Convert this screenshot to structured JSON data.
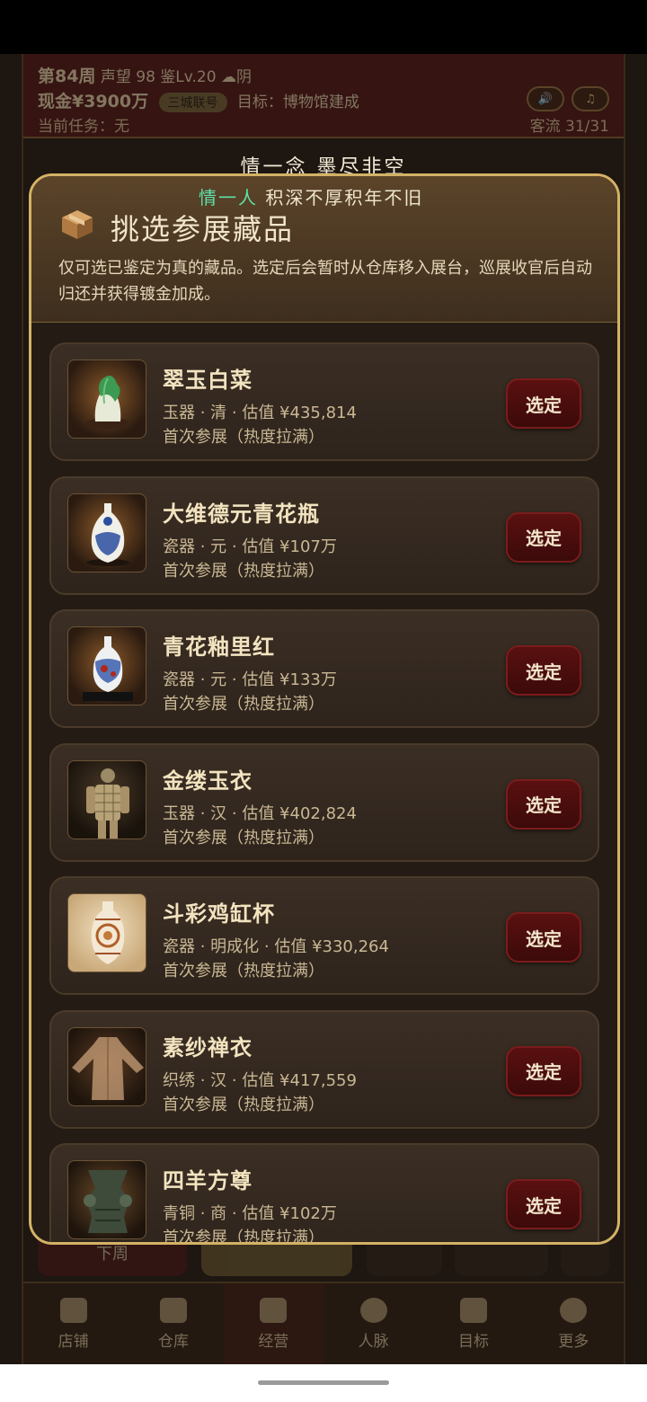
{
  "header": {
    "week": "第84周",
    "reputation": "声望 98",
    "appraisal_level": "鉴Lv.20",
    "weather": "☁阴",
    "cash": "现金¥3900万",
    "chip": "三城联号",
    "goal": "目标：博物馆建成",
    "task": "当前任务：无",
    "traffic": "客流 31/31",
    "btn_sound": "🔊",
    "btn_music": "♫"
  },
  "poem_top": "情一念 墨尽非空",
  "poem_modal": {
    "highlight": "情一人",
    "rest": " 积深不厚积年不旧"
  },
  "modal": {
    "icon": "package-icon",
    "title": "挑选参展藏品",
    "description": "仅可选已鉴定为真的藏品。选定后会暂时从仓库移入展台，巡展收官后自动归还并获得镀金加成。"
  },
  "items": [
    {
      "name": "翠玉白菜",
      "meta": "玉器 · 清 · 估值 ¥435,814",
      "note": "首次参展（热度拉满）",
      "button": "选定",
      "icon": "jade-cabbage-image"
    },
    {
      "name": "大维德元青花瓶",
      "meta": "瓷器 · 元 · 估值 ¥107万",
      "note": "首次参展（热度拉满）",
      "button": "选定",
      "icon": "blue-white-vase-image"
    },
    {
      "name": "青花釉里红",
      "meta": "瓷器 · 元 · 估值 ¥133万",
      "note": "首次参展（热度拉满）",
      "button": "选定",
      "icon": "red-blue-vase-image"
    },
    {
      "name": "金缕玉衣",
      "meta": "玉器 · 汉 · 估值 ¥402,824",
      "note": "首次参展（热度拉满）",
      "button": "选定",
      "icon": "jade-suit-image"
    },
    {
      "name": "斗彩鸡缸杯",
      "meta": "瓷器 · 明成化 · 估值 ¥330,264",
      "note": "首次参展（热度拉满）",
      "button": "选定",
      "icon": "doucai-vase-image"
    },
    {
      "name": "素纱禅衣",
      "meta": "织绣 · 汉 · 估值 ¥417,559",
      "note": "首次参展（热度拉满）",
      "button": "选定",
      "icon": "silk-robe-image"
    },
    {
      "name": "四羊方尊",
      "meta": "青铜 · 商 · 估值 ¥102万",
      "note": "首次参展（热度拉满）",
      "button": "选定",
      "icon": "bronze-zun-image"
    }
  ],
  "bottom_strip": {
    "next_week": "下周"
  },
  "nav": [
    {
      "label": "店铺",
      "icon": "shop-icon"
    },
    {
      "label": "仓库",
      "icon": "warehouse-icon"
    },
    {
      "label": "经营",
      "icon": "business-icon"
    },
    {
      "label": "人脉",
      "icon": "people-icon"
    },
    {
      "label": "目标",
      "icon": "goal-icon"
    },
    {
      "label": "更多",
      "icon": "more-icon"
    }
  ],
  "colors": {
    "accent_gold": "#d4b266",
    "button_red": "#5a1010",
    "header_red": "#4a1414",
    "poem_green": "#5fe0a8"
  }
}
